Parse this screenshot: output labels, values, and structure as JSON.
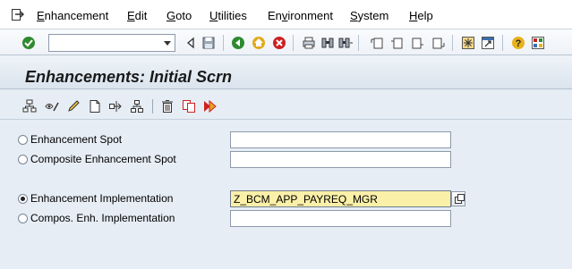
{
  "menu": {
    "items": [
      "Enhancement",
      "Edit",
      "Goto",
      "Utilities",
      "Environment",
      "System",
      "Help"
    ],
    "accel": [
      "E",
      "E",
      "G",
      "U",
      "v",
      "S",
      "H"
    ]
  },
  "toolbar": {
    "command_field_value": "",
    "icons": [
      "enter-checkmark-icon",
      "back-nav-icon",
      "save-icon",
      "back-icon",
      "exit-icon",
      "cancel-icon",
      "print-icon",
      "find-icon",
      "find-next-icon",
      "first-page-icon",
      "previous-page-icon",
      "next-page-icon",
      "last-page-icon",
      "create-session-icon",
      "shortcut-icon",
      "help-icon",
      "layout-menu-icon"
    ]
  },
  "title": "Enhancements: Initial Scrn",
  "app_toolbar": {
    "icons": [
      "object-list-icon",
      "display-change-icon",
      "edit-pencil-icon",
      "create-icon",
      "where-used-icon",
      "hierarchy-icon",
      "delete-icon",
      "copy-icon",
      "activate-icon"
    ]
  },
  "form": {
    "rows": [
      {
        "label": "Enhancement Spot",
        "value": "",
        "selected": false
      },
      {
        "label": "Composite Enhancement Spot",
        "value": "",
        "selected": false
      },
      {
        "label": "Enhancement Implementation",
        "value": "Z_BCM_APP_PAYREQ_MGR",
        "selected": true
      },
      {
        "label": "Compos. Enh. Implementation",
        "value": "",
        "selected": false
      }
    ]
  },
  "colors": {
    "background": "#e6edf5",
    "active_field": "#fbf0a8",
    "title_text": "#1a1a1a"
  }
}
